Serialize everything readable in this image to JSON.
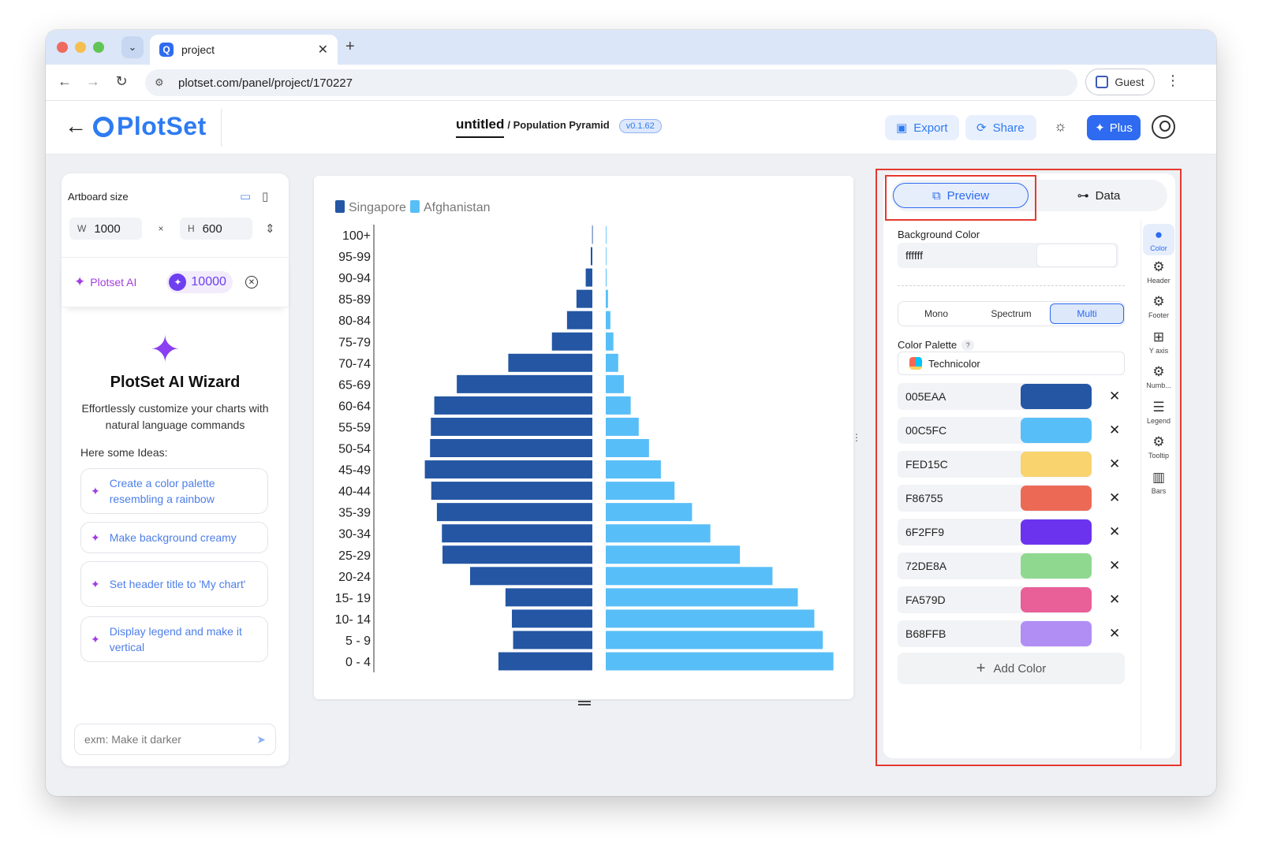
{
  "browser": {
    "tab_title": "project",
    "url": "plotset.com/panel/project/170227",
    "profile_label": "Guest"
  },
  "app": {
    "logo_text": "PlotSet",
    "project_name": "untitled",
    "chart_type": "/ Population Pyramid",
    "version": "v0.1.62",
    "export_label": "Export",
    "share_label": "Share",
    "plus_label": "Plus"
  },
  "left_panel": {
    "artboard_label": "Artboard size",
    "width_key": "W",
    "width_value": "1000",
    "times": "×",
    "height_key": "H",
    "height_value": "600",
    "ai_label": "Plotset AI",
    "credits": "10000",
    "wizard_title": "PlotSet AI Wizard",
    "wizard_description": "Effortlessly customize your charts with natural language commands",
    "ideas_label": "Here some Ideas:",
    "ideas": [
      "Create a color palette resembling a rainbow",
      "Make background creamy",
      "Set header title to 'My chart'",
      "Display legend and make it vertical"
    ],
    "prompt_placeholder": "exm: Make it darker"
  },
  "chart_data": {
    "type": "bar",
    "orientation": "population-pyramid",
    "categories": [
      "100+",
      "95-99",
      "90-94",
      "85-89",
      "80-84",
      "75-79",
      "70-74",
      "65-69",
      "60-64",
      "55-59",
      "50-54",
      "45-49",
      "40-44",
      "35-39",
      "30-34",
      "25-29",
      "20-24",
      "15- 19",
      "10- 14",
      "5 - 9",
      "0 - 4"
    ],
    "series": [
      {
        "name": "Singapore",
        "color": "#2456a4",
        "values": [
          0.1,
          0.8,
          3.3,
          7.9,
          12.6,
          20.1,
          41.8,
          67.4,
          78.6,
          80.3,
          80.7,
          83.3,
          80.1,
          77.3,
          74.8,
          74.5,
          60.8,
          43.2,
          40.0,
          39.4,
          46.7
        ]
      },
      {
        "name": "Afghanistan",
        "color": "#58bef7",
        "values": [
          0.1,
          0.2,
          0.4,
          1.1,
          2.3,
          3.8,
          6.2,
          9.0,
          12.4,
          16.4,
          21.5,
          27.4,
          34.2,
          42.9,
          52.0,
          66.7,
          82.9,
          95.5,
          103.7,
          107.9,
          113.2
        ]
      }
    ],
    "legend": "top-left",
    "grid": false,
    "xlabel": "",
    "ylabel": ""
  },
  "right_panel": {
    "tabs": {
      "preview": "Preview",
      "data": "Data"
    },
    "background_label": "Background Color",
    "background_value": "ffffff",
    "modes": [
      "Mono",
      "Spectrum",
      "Multi"
    ],
    "palette_label": "Color Palette",
    "help_glyph": "?",
    "palette_name": "Technicolor",
    "colors": [
      {
        "hex": "005EAA",
        "swatch": "#2456a4"
      },
      {
        "hex": "00C5FC",
        "swatch": "#58bef7"
      },
      {
        "hex": "FED15C",
        "swatch": "#f8d36e"
      },
      {
        "hex": "F86755",
        "swatch": "#ec6a55"
      },
      {
        "hex": "6F2FF9",
        "swatch": "#6b33ee"
      },
      {
        "hex": "72DE8A",
        "swatch": "#8fd88f"
      },
      {
        "hex": "FA579D",
        "swatch": "#e95f97"
      },
      {
        "hex": "B68FFB",
        "swatch": "#b08ef4"
      }
    ],
    "add_color_label": "Add Color",
    "rail": [
      {
        "label": "Color",
        "icon": "palette-icon"
      },
      {
        "label": "Header",
        "icon": "gear-icon"
      },
      {
        "label": "Footer",
        "icon": "gear-icon"
      },
      {
        "label": "Y axis",
        "icon": "grid-icon"
      },
      {
        "label": "Numb...",
        "icon": "gear-icon"
      },
      {
        "label": "Legend",
        "icon": "legend-icon"
      },
      {
        "label": "Tooltip",
        "icon": "gear-icon"
      },
      {
        "label": "Bars",
        "icon": "bar-chart-icon"
      }
    ]
  }
}
